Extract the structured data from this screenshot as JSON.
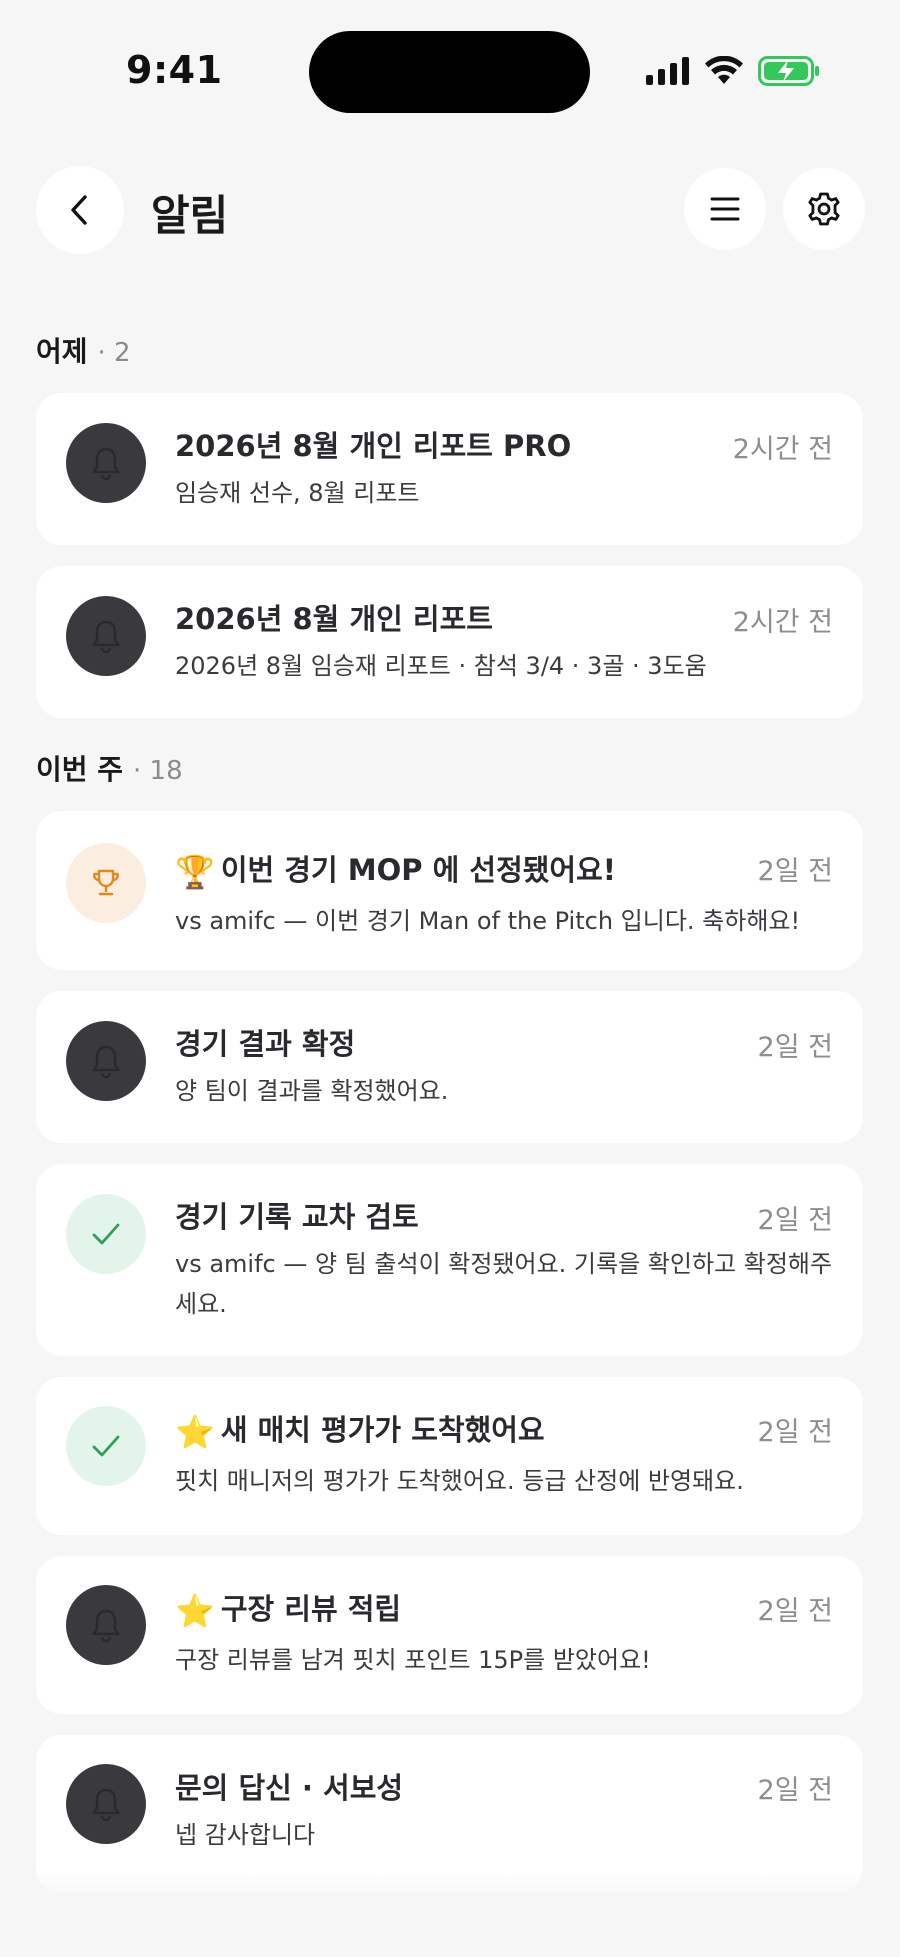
{
  "status_bar": {
    "time": "9:41",
    "battery_color": "#34c759"
  },
  "header": {
    "title": "알림",
    "back_icon": "chevron-left-icon",
    "menu_icon": "hamburger-menu-icon",
    "settings_icon": "gear-icon"
  },
  "sections": [
    {
      "title": "어제",
      "count": "· 2",
      "items": [
        {
          "icon": "bell-icon",
          "title": "2026년 8월 개인 리포트 PRO",
          "time": "2시간 전",
          "body": "임승재 선수, 8월 리포트"
        },
        {
          "icon": "bell-icon",
          "title": "2026년 8월 개인 리포트",
          "time": "2시간 전",
          "body": "2026년 8월 임승재 리포트 · 참석 3/4 · 3골 · 3도움"
        }
      ]
    },
    {
      "title": "이번 주",
      "count": "· 18",
      "items": [
        {
          "icon": "trophy-icon",
          "emoji": "🏆",
          "title": "이번 경기 MOP 에 선정됐어요!",
          "time": "2일 전",
          "body": "vs amifc — 이번 경기 Man of the Pitch 입니다. 축하해요!"
        },
        {
          "icon": "bell-icon",
          "title": "경기 결과 확정",
          "time": "2일 전",
          "body": "양 팀이 결과를 확정했어요."
        },
        {
          "icon": "checkmark-icon",
          "title": "경기 기록 교차 검토",
          "time": "2일 전",
          "body": "vs amifc — 양 팀 출석이 확정됐어요. 기록을 확인하고 확정해주세요."
        },
        {
          "icon": "checkmark-icon",
          "emoji": "⭐",
          "title": "새 매치 평가가 도착했어요",
          "time": "2일 전",
          "body": "핏치 매니저의 평가가 도착했어요. 등급 산정에 반영돼요."
        },
        {
          "icon": "bell-icon",
          "emoji": "⭐",
          "title": "구장 리뷰 적립",
          "time": "2일 전",
          "body": "구장 리뷰를 남겨 핏치 포인트 15P를 받았어요!"
        },
        {
          "icon": "bell-icon",
          "title": "문의 답신 · 서보성",
          "time": "2일 전",
          "body": "넵 감사합니다"
        }
      ]
    }
  ],
  "colors": {
    "background": "#f6f6f7",
    "card": "#ffffff",
    "icon_dark": "#3a3a3e",
    "icon_orange_bg": "#fbeee0",
    "trophy": "#e08a1e",
    "icon_green_bg": "#e3f4ea",
    "check": "#2f9e5a",
    "meta_text": "#8d8d92"
  }
}
